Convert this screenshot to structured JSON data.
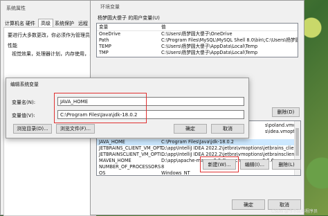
{
  "sysprops": {
    "title": "系统属性",
    "tabs": [
      "计算机名",
      "硬件",
      "高级",
      "系统保护",
      "远程"
    ],
    "admin_note": "要进行大多数更改，你必须作为管理员登",
    "perf_label": "性能",
    "perf_desc": "视觉效果，处理器计划，内存使用，以及"
  },
  "envvars": {
    "title": "环境变量",
    "user_section": "杨梦圆大傻子 的用户变量(U)",
    "col_var": "变量",
    "col_val": "值",
    "user_rows": [
      {
        "name": "OneDrive",
        "value": "C:\\Users\\杨梦圆大傻子\\OneDrive"
      },
      {
        "name": "Path",
        "value": "C:\\Program Files\\MySQL\\MySQL Shell 8.0\\bin\\;C:\\Users\\杨梦圆大傻子"
      },
      {
        "name": "TEMP",
        "value": "C:\\Users\\杨梦圆大傻子\\AppData\\Local\\Temp"
      },
      {
        "name": "TMP",
        "value": "C:\\Users\\杨梦圆大傻子\\AppData\\Local\\Temp"
      }
    ],
    "user_delete": "删除(D)",
    "sys_values_partial": [
      "s\\poland.vmoptions",
      "s\\idea.vmoptions"
    ],
    "sys_rows": [
      {
        "name": "JAVA_HOME",
        "value": "C:\\Program Files\\Java\\jdk-18.0.2"
      },
      {
        "name": "JETBRAINS_CLIENT_VM_OPT...",
        "value": "D:\\app\\IntelliJ IDEA 2022.2\\jetbra\\vmoptions\\jetbrains_client.vmo"
      },
      {
        "name": "JETBRAINSCLIENT_VM_OPTI...",
        "value": "D:\\app\\IntelliJ IDEA 2022.2\\jetbra\\vmoptions\\jetbrainsclient.vmo"
      },
      {
        "name": "MAVEN_HOME",
        "value": "D:\\app\\apache-maven-3.8.6\\apache-maven-3.8.6"
      },
      {
        "name": "NUMBER_OF_PROCESSORS",
        "value": "8"
      },
      {
        "name": "OS",
        "value": "Windows_NT"
      }
    ],
    "new_btn": "新建(W)...",
    "edit_btn": "编辑(I)...",
    "delete_btn": "删除(L)",
    "ok_btn": "确定",
    "cancel_btn": "取消"
  },
  "editdlg": {
    "title": "编辑系统变量",
    "name_label": "变量名(N):",
    "name_value": "JAVA_HOME",
    "value_label": "变量值(V):",
    "value_value": "C:\\Program Files\\Java\\jdk-18.0.2",
    "browse_dir": "浏览目录(D)...",
    "browse_file": "浏览文件(F)...",
    "ok": "确定",
    "cancel": "取消"
  },
  "watermark": "CSDN @今不应与程序员",
  "colors": {
    "highlight": "#e03030",
    "selected_row": "#cce8ff"
  }
}
